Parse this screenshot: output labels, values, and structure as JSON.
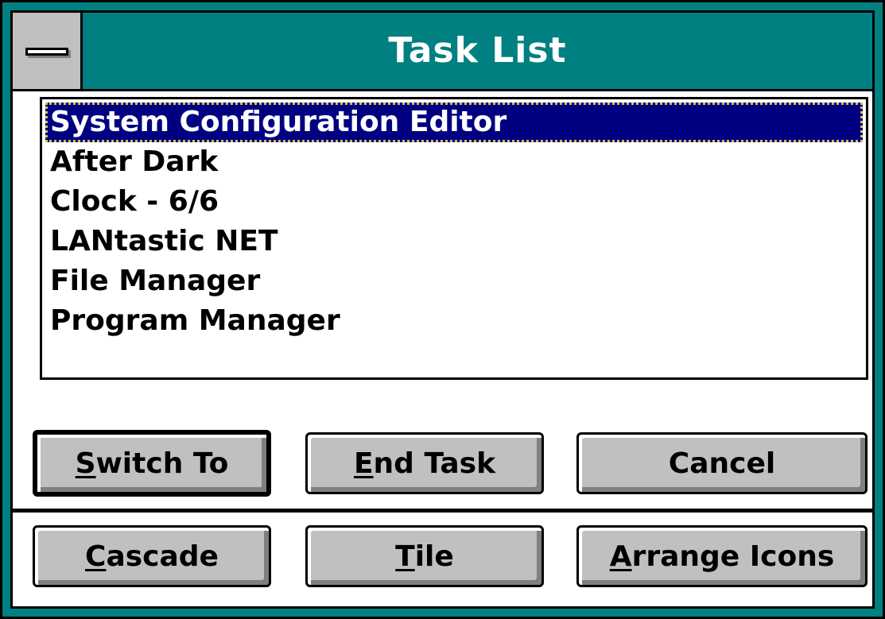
{
  "window": {
    "title": "Task List",
    "colors": {
      "title_bar": "#008080",
      "selection": "#000080",
      "button_face": "#c0c0c0"
    },
    "system_menu_icon": "system-menu-icon"
  },
  "task_list": {
    "items": [
      "System Configuration Editor",
      "After Dark",
      "Clock - 6/6",
      "LANtastic NET",
      "File Manager",
      "Program Manager"
    ],
    "selected_index": 0
  },
  "buttons": {
    "switch_to": {
      "mnemonic": "S",
      "rest": "witch To"
    },
    "end_task": {
      "mnemonic": "E",
      "rest": "nd Task"
    },
    "cancel": {
      "label": "Cancel"
    },
    "cascade": {
      "mnemonic": "C",
      "rest": "ascade"
    },
    "tile": {
      "mnemonic": "T",
      "rest": "ile"
    },
    "arrange_icons": {
      "mnemonic": "A",
      "rest": "rrange Icons"
    }
  }
}
